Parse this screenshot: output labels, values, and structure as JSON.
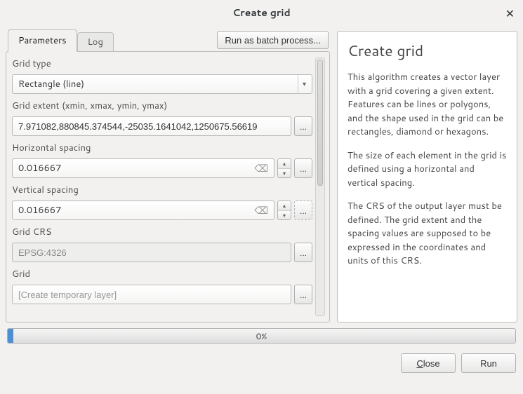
{
  "window": {
    "title": "Create grid"
  },
  "tabs": {
    "parameters": "Parameters",
    "log": "Log"
  },
  "batch_button": "Run as batch process...",
  "fields": {
    "grid_type": {
      "label": "Grid type",
      "value": "Rectangle (line)"
    },
    "grid_extent": {
      "label": "Grid extent (xmin, xmax, ymin, ymax)",
      "value": "7.971082,880845.374544,-25035.1641042,1250675.56619"
    },
    "hspacing": {
      "label": "Horizontal spacing",
      "value": "0.016667"
    },
    "vspacing": {
      "label": "Vertical spacing",
      "value": "0.016667"
    },
    "grid_crs": {
      "label": "Grid CRS",
      "value": "EPSG:4326"
    },
    "grid_output": {
      "label": "Grid",
      "placeholder": "[Create temporary layer]"
    }
  },
  "help": {
    "title": "Create grid",
    "p1": "This algorithm creates a vector layer with a grid covering a given extent. Features can be lines or polygons, and the shape used in the grid can be rectangles, diamond or hexagons.",
    "p2": "The size of each element in the grid is defined using a horizontal and vertical spacing.",
    "p3": "The CRS of the output layer must be defined. The grid extent and the spacing values are supposed to be expressed in the coordinates and units of this CRS."
  },
  "progress": {
    "text": "0%"
  },
  "buttons": {
    "close": "Close",
    "run": "Run"
  }
}
